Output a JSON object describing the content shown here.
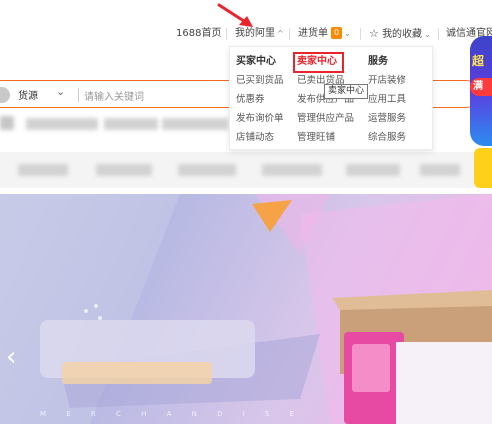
{
  "topbar": {
    "home": "1688首页",
    "my_alibaba": "我的阿里",
    "cart": "进货单",
    "cart_count": "0",
    "favorites": "我的收藏",
    "trust": "诚信通官网",
    "star_icon": "star-icon"
  },
  "search": {
    "type_label": "货源",
    "placeholder": "请输入关键词"
  },
  "dropdown": {
    "buyer": {
      "title": "买家中心",
      "items": [
        "已买到货品",
        "优惠券",
        "发布询价单",
        "店铺动态"
      ]
    },
    "seller": {
      "title": "卖家中心",
      "items": [
        "已卖出货品",
        "发布供应产品",
        "管理供应产品",
        "管理旺铺"
      ],
      "tooltip": "卖家中心"
    },
    "service": {
      "title": "服务",
      "items": [
        "开店装修",
        "应用工具",
        "运营服务",
        "综合服务"
      ]
    }
  },
  "promo": {
    "text": "超",
    "badge": "满"
  },
  "banner": {
    "prev_icon": "chevron-left-icon",
    "watermark": "M E R C H A N D I S E"
  },
  "colors": {
    "accent": "#f56b1c",
    "highlight": "#e8242c",
    "badge": "#ff8a00"
  }
}
